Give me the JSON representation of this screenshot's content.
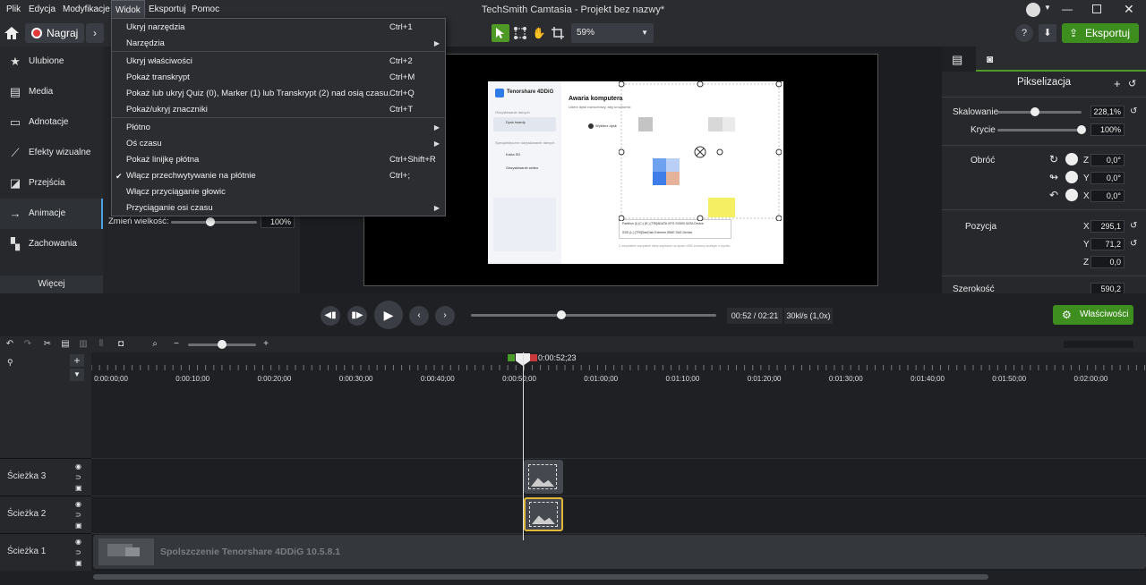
{
  "menubar": {
    "items": [
      "Plik",
      "Edycja",
      "Modyfikacje",
      "Widok",
      "Eksportuj",
      "Pomoc"
    ]
  },
  "app_title": "TechSmith Camtasia - Projekt bez nazwy*",
  "toolbar": {
    "record_label": "Nagraj",
    "zoom_value": "59%",
    "export_label": "Eksportuj",
    "help_label": "?"
  },
  "sidebar": {
    "items": [
      {
        "label": "Ulubione",
        "icon": "star-icon"
      },
      {
        "label": "Media",
        "icon": "film-icon"
      },
      {
        "label": "Adnotacje",
        "icon": "annotation-icon"
      },
      {
        "label": "Efekty wizualne",
        "icon": "magic-wand-icon"
      },
      {
        "label": "Przejścia",
        "icon": "transition-icon"
      },
      {
        "label": "Animacje",
        "icon": "animation-icon"
      },
      {
        "label": "Zachowania",
        "icon": "behavior-icon"
      }
    ],
    "more_label": "Więcej"
  },
  "toolpanel": {
    "resize_label": "Zmień wielkość:",
    "resize_value": "100%"
  },
  "dropdown": {
    "items": [
      {
        "label": "Ukryj narzędzia",
        "shortcut": "Ctrl+1"
      },
      {
        "label": "Narzędzia",
        "submenu": true
      },
      {
        "label": "Ukryj właściwości",
        "shortcut": "Ctrl+2"
      },
      {
        "label": "Pokaż transkrypt",
        "shortcut": "Ctrl+M"
      },
      {
        "label": "Pokaż lub ukryj Quiz (0), Marker (1) lub Transkrypt (2) nad osią czasu.",
        "shortcut": "Ctrl+Q"
      },
      {
        "label": "Pokaż/ukryj znaczniki",
        "shortcut": "Ctrl+T"
      },
      {
        "label": "Płótno",
        "submenu": true
      },
      {
        "label": "Oś czasu",
        "submenu": true
      },
      {
        "label": "Pokaż linijkę płótna",
        "shortcut": "Ctrl+Shift+R"
      },
      {
        "label": "Włącz przechwytywanie na płótnie",
        "shortcut": "Ctrl+;",
        "checked": true
      },
      {
        "label": "Włącz przyciąganie głowic"
      },
      {
        "label": "Przyciąganie osi czasu",
        "submenu": true
      }
    ]
  },
  "canvas_content": {
    "app_name": "Tenorshare 4DDiG",
    "heading": "Awaria komputera",
    "subtext": "Uderz dysk rozruchowy, aby uruchomić",
    "step": "Wybierz dysk",
    "nav": [
      "Odzyskiwanie danych",
      "Dysk twardy",
      "Specjalistyczne odzyskiwanie danych",
      "Karta SD",
      "Odzyskiwanie wideo"
    ],
    "line1": "Partition (I) (C:) (E:) [TRI]ADATA XPG SX500 SATA Device",
    "line2": "SSD (L:) [TRI]SanDisk Extreme 55AE SAS Device",
    "note": "Z wszystkimi wszystkie dane zapisane na dysku USB zostaną usunięte z wyniku."
  },
  "properties": {
    "title": "Pikselizacja",
    "scale_label": "Skalowanie",
    "scale_value": "228,1%",
    "scale_level": 0.45,
    "opacity_label": "Krycie",
    "opacity_value": "100%",
    "opacity_level": 1.0,
    "rotate_label": "Obróć",
    "rz": "0,0°",
    "ry": "0,0°",
    "rx": "0,0°",
    "position_label": "Pozycja",
    "px": "295,1",
    "py": "71,2",
    "pz": "0,0",
    "width_label": "Szerokość",
    "width_value": "590,2",
    "axis_z": "Z",
    "axis_y": "Y",
    "axis_x": "X"
  },
  "playback": {
    "time": "00:52 / 02:21",
    "fps": "30kl/s (1,0x)",
    "properties_label": "Właściwości",
    "progress": 0.37
  },
  "timeline": {
    "playhead_time": "0:00:52;23",
    "ticks": [
      "0:00:00;00",
      "0:00:10;00",
      "0:00:20;00",
      "0:00:30;00",
      "0:00:40;00",
      "0:00:50;00",
      "0:01:00;00",
      "0:01:10;00",
      "0:01:20;00",
      "0:01:30;00",
      "0:01:40;00",
      "0:01:50;00",
      "0:02:00;00"
    ],
    "tracks": [
      {
        "name": "Ścieżka 3"
      },
      {
        "name": "Ścieżka 2"
      },
      {
        "name": "Ścieżka 1"
      }
    ],
    "clip_label": "Spolszczenie Tenorshare 4DDiG 10.5.8.1"
  }
}
